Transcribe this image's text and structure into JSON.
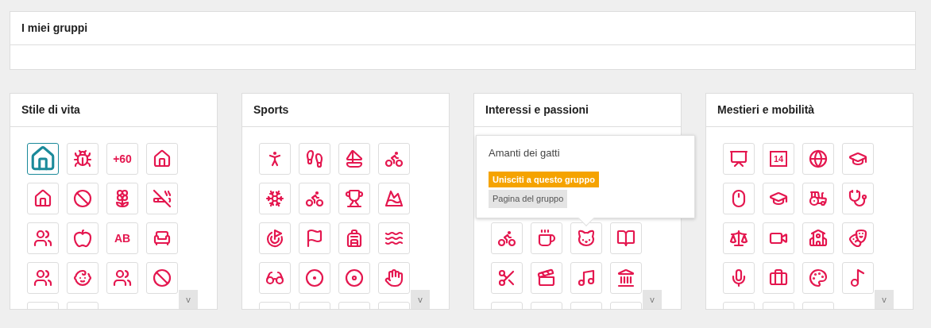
{
  "my_groups": {
    "title": "I miei gruppi"
  },
  "panels": [
    {
      "title": "Stile di vita",
      "scroll_label": "v",
      "tiles": [
        {
          "kind": "icon",
          "member": true
        },
        {
          "kind": "icon",
          "member": false
        },
        {
          "kind": "text",
          "text": "+60",
          "member": false
        },
        {
          "kind": "icon",
          "member": false
        },
        {
          "kind": "icon",
          "member": false
        },
        {
          "kind": "icon",
          "member": false
        },
        {
          "kind": "icon",
          "member": false
        },
        {
          "kind": "icon",
          "member": false
        },
        {
          "kind": "icon",
          "member": false
        },
        {
          "kind": "icon",
          "member": false
        },
        {
          "kind": "text",
          "text": "AB",
          "member": false
        },
        {
          "kind": "icon",
          "member": false
        },
        {
          "kind": "icon",
          "member": false
        },
        {
          "kind": "icon",
          "member": false
        },
        {
          "kind": "icon",
          "member": false
        },
        {
          "kind": "icon",
          "member": false
        },
        {
          "kind": "icon",
          "member": false
        },
        {
          "kind": "icon",
          "member": false
        }
      ]
    },
    {
      "title": "Sports",
      "scroll_label": "v",
      "tiles": [
        {
          "kind": "icon",
          "member": false
        },
        {
          "kind": "icon",
          "member": false
        },
        {
          "kind": "icon",
          "member": false
        },
        {
          "kind": "icon",
          "member": false
        },
        {
          "kind": "icon",
          "member": false
        },
        {
          "kind": "icon",
          "member": false
        },
        {
          "kind": "icon",
          "member": false
        },
        {
          "kind": "icon",
          "member": false
        },
        {
          "kind": "icon",
          "member": false
        },
        {
          "kind": "icon",
          "member": false
        },
        {
          "kind": "icon",
          "member": false
        },
        {
          "kind": "icon",
          "member": false
        },
        {
          "kind": "icon",
          "member": false
        },
        {
          "kind": "icon",
          "member": false
        },
        {
          "kind": "icon",
          "member": false
        },
        {
          "kind": "icon",
          "member": false
        },
        {
          "kind": "icon",
          "member": false
        },
        {
          "kind": "icon",
          "member": false
        },
        {
          "kind": "icon",
          "member": false
        },
        {
          "kind": "icon",
          "member": false
        }
      ]
    },
    {
      "title": "Interessi e passioni",
      "scroll_label": "v",
      "popup": {
        "title": "Amanti dei gatti",
        "join_button": "Unisciti a questo gruppo",
        "page_button": "Pagina del gruppo"
      },
      "tiles": [
        {
          "kind": "icon",
          "member": false
        },
        {
          "kind": "icon",
          "member": false
        },
        {
          "kind": "icon",
          "member": false
        },
        {
          "kind": "icon",
          "member": false
        },
        {
          "kind": "icon",
          "member": false
        },
        {
          "kind": "icon",
          "member": false
        },
        {
          "kind": "icon",
          "member": false
        },
        {
          "kind": "icon",
          "member": false
        },
        {
          "kind": "icon",
          "member": false
        },
        {
          "kind": "icon",
          "member": false
        },
        {
          "kind": "icon",
          "member": false
        },
        {
          "kind": "icon",
          "member": false
        }
      ]
    },
    {
      "title": "Mestieri e mobilità",
      "scroll_label": "v",
      "tiles": [
        {
          "kind": "icon",
          "member": false
        },
        {
          "kind": "calendar",
          "text": "14",
          "member": false
        },
        {
          "kind": "icon",
          "member": false
        },
        {
          "kind": "icon",
          "member": false
        },
        {
          "kind": "icon",
          "member": false
        },
        {
          "kind": "icon",
          "member": false
        },
        {
          "kind": "icon",
          "member": false
        },
        {
          "kind": "icon",
          "member": false
        },
        {
          "kind": "icon",
          "member": false
        },
        {
          "kind": "icon",
          "member": false
        },
        {
          "kind": "icon",
          "member": false
        },
        {
          "kind": "icon",
          "member": false
        },
        {
          "kind": "icon",
          "member": false
        },
        {
          "kind": "icon",
          "member": false
        },
        {
          "kind": "icon",
          "member": false
        },
        {
          "kind": "icon",
          "member": false
        },
        {
          "kind": "icon",
          "member": false
        },
        {
          "kind": "icon",
          "member": false
        },
        {
          "kind": "icon",
          "member": false
        }
      ]
    }
  ]
}
